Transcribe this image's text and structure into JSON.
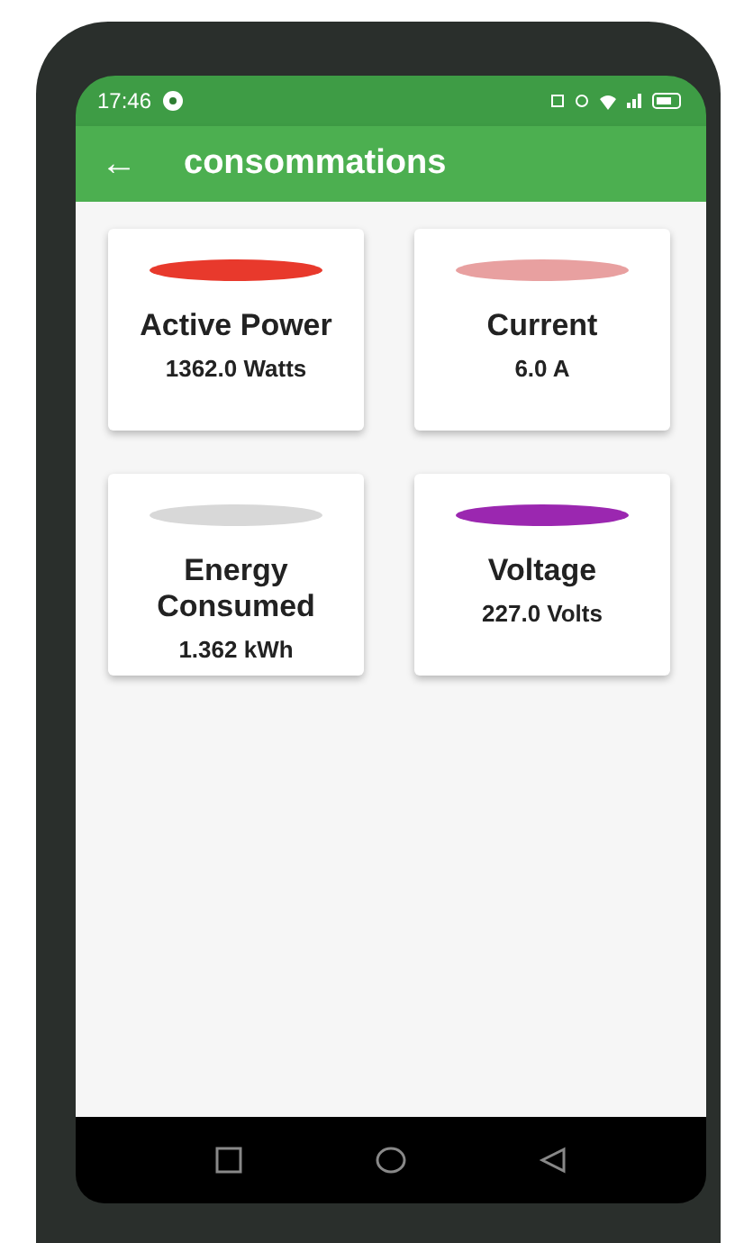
{
  "status_bar": {
    "time": "17:46"
  },
  "app_bar": {
    "back": "←",
    "title": "consommations"
  },
  "cards": [
    {
      "title": "Active Power",
      "value": "1362.0 Watts",
      "color": "#e8392c"
    },
    {
      "title": "Current",
      "value": "6.0 A",
      "color": "#e8a0a0"
    },
    {
      "title": "Energy Consumed",
      "value": "1.362 kWh",
      "color": "#d8d8d8"
    },
    {
      "title": "Voltage",
      "value": "227.0 Volts",
      "color": "#9b27b0"
    }
  ]
}
